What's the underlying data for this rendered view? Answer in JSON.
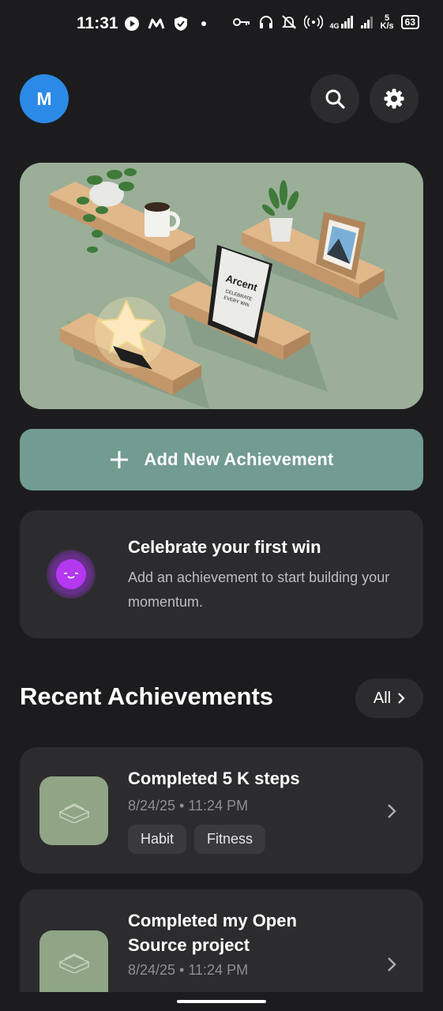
{
  "status_bar": {
    "time": "11:31",
    "network_speed_top": "5",
    "network_speed_bottom": "K/s",
    "network_type": "4G",
    "battery": "63"
  },
  "header": {
    "avatar_initial": "M",
    "avatar_color": "#2b8ae6"
  },
  "hero": {
    "book_title": "Arcent",
    "book_subtitle_line1": "CELEBRATE",
    "book_subtitle_line2": "EVERY WIN"
  },
  "add_button": {
    "plus": "+",
    "label": "Add New Achievement",
    "color": "#729b92"
  },
  "celebrate_card": {
    "title": "Celebrate your first win",
    "subtitle": "Add an achievement to start building your momentum."
  },
  "recent": {
    "title": "Recent Achievements",
    "all_label": "All",
    "items": [
      {
        "title": "Completed 5 K steps",
        "date": "8/24/25 • 11:24 PM",
        "tags": [
          "Habit",
          "Fitness"
        ]
      },
      {
        "title": "Completed my Open Source project",
        "date": "8/24/25 • 11:24 PM",
        "tags": []
      }
    ]
  },
  "colors": {
    "background": "#1c1c1e",
    "card": "#2c2c2e",
    "thumb": "#8fa585",
    "accent_purple": "#b438f0"
  }
}
